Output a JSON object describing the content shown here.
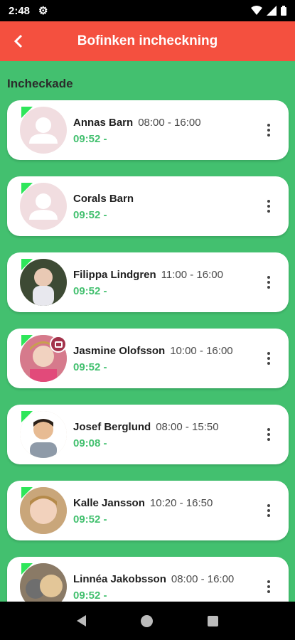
{
  "status_bar": {
    "time": "2:48"
  },
  "app_bar": {
    "title": "Bofinken incheckning"
  },
  "section_title": "Incheckade",
  "children": [
    {
      "name": "Annas Barn",
      "schedule": "08:00 - 16:00",
      "checkin": "09:52 -"
    },
    {
      "name": "Corals Barn",
      "schedule": "",
      "checkin": "09:52 -"
    },
    {
      "name": "Filippa Lindgren",
      "schedule": "11:00 - 16:00",
      "checkin": "09:52 -"
    },
    {
      "name": "Jasmine Olofsson",
      "schedule": "10:00 - 16:00",
      "checkin": "09:52 -"
    },
    {
      "name": "Josef Berglund",
      "schedule": "08:00 - 15:50",
      "checkin": "09:08 -"
    },
    {
      "name": "Kalle Jansson",
      "schedule": "10:20 - 16:50",
      "checkin": "09:52 -"
    },
    {
      "name": "Linnéa Jakobsson",
      "schedule": "08:00 - 16:00",
      "checkin": "09:52 -"
    }
  ],
  "colors": {
    "background": "#43c06f",
    "app_bar": "#f4503f",
    "checkin_text": "#43c06f",
    "flag": "#2ee65a"
  }
}
